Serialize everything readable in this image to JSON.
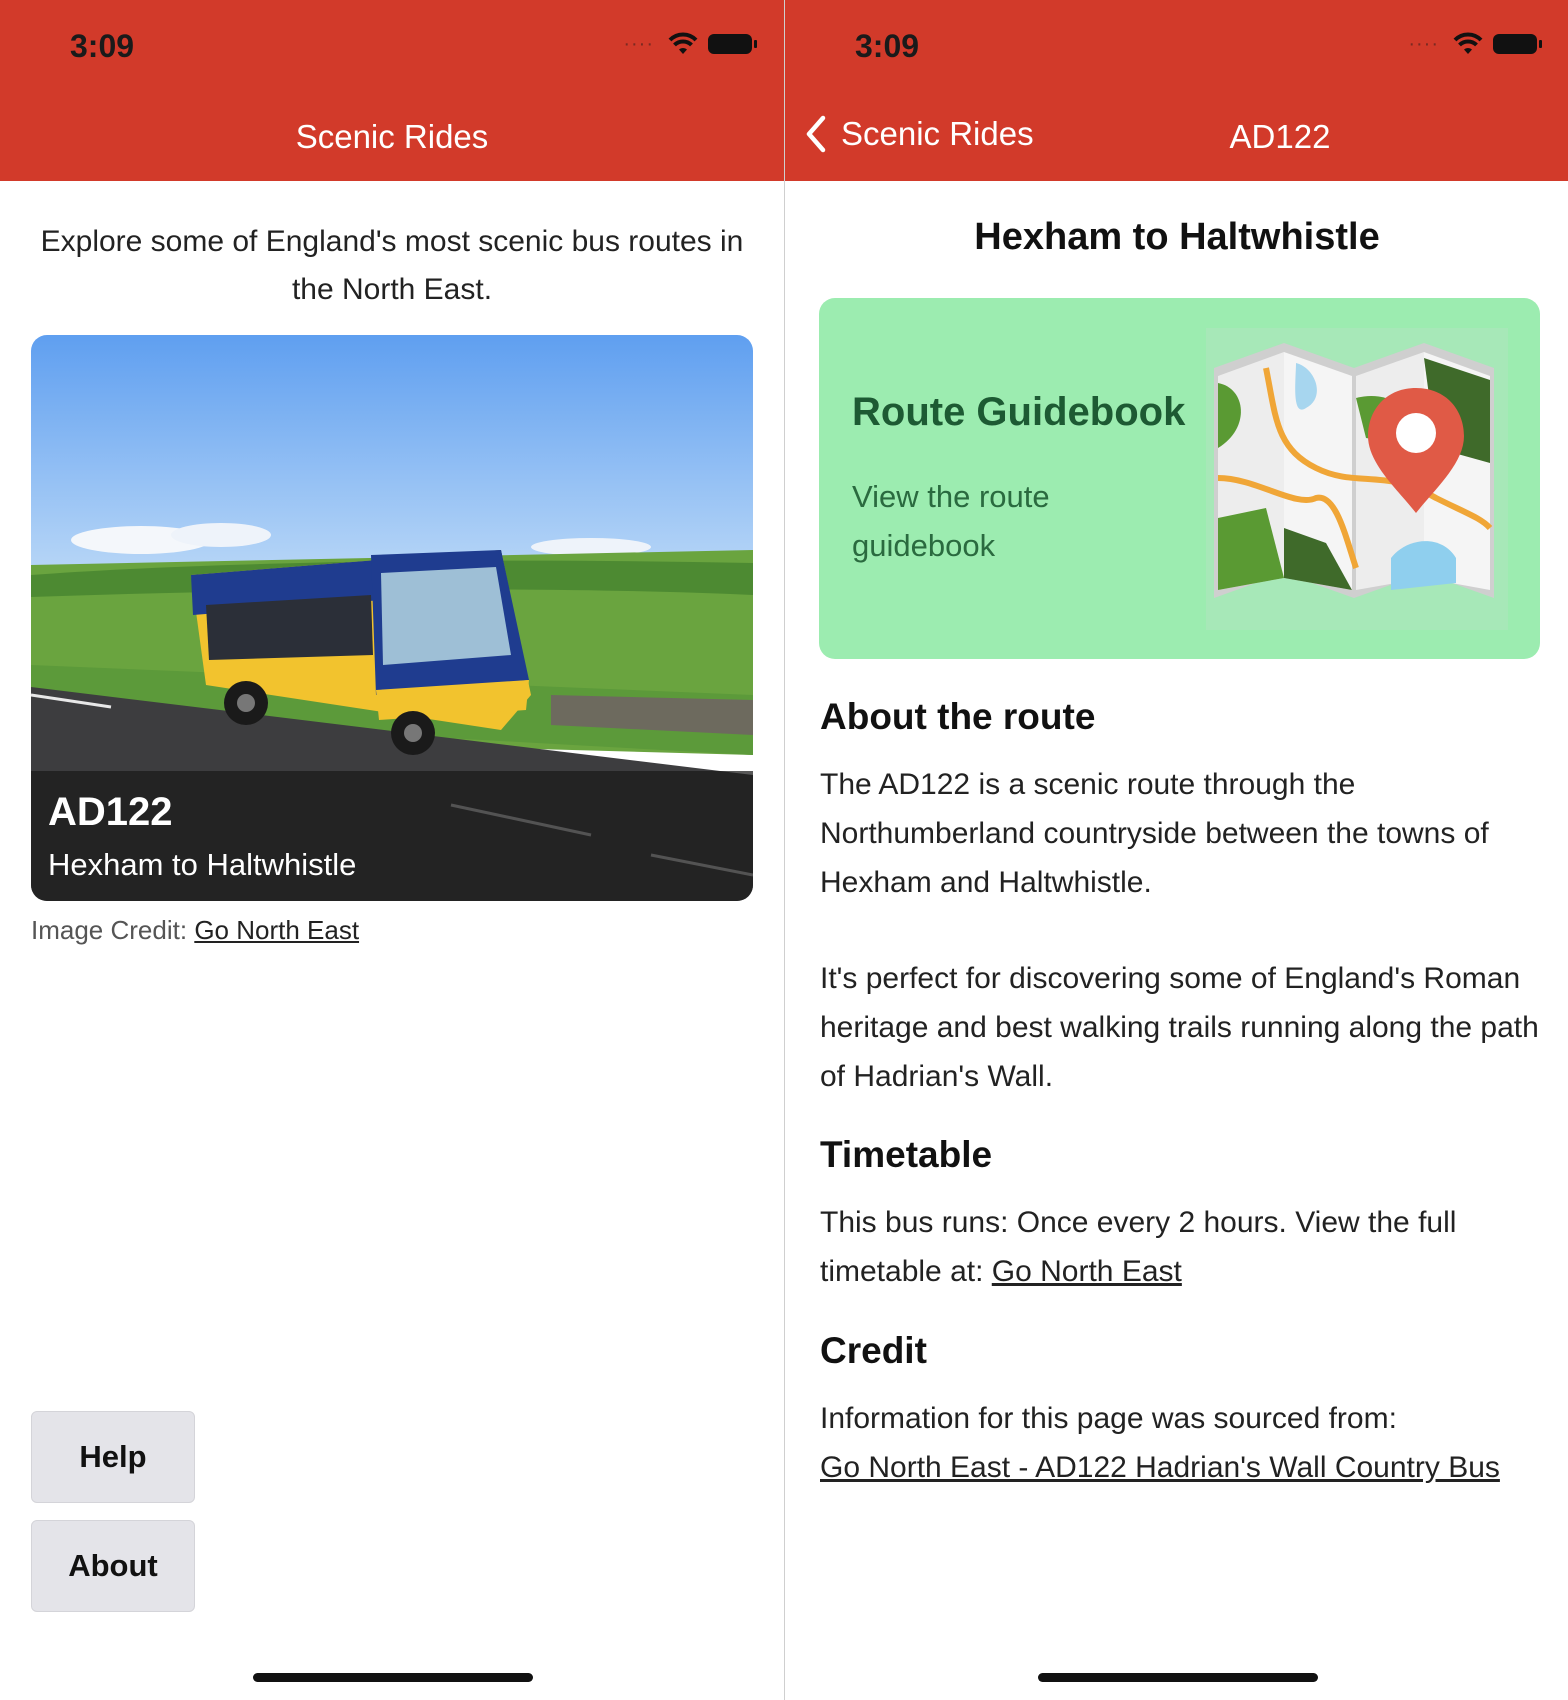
{
  "colors": {
    "nav_bar": "#d23a2a",
    "guidebook_card": "#9cecb0",
    "button_bg": "#e4e4e9"
  },
  "left_screen": {
    "status": {
      "time": "3:09",
      "icons": [
        "cellular-icon",
        "wifi-icon",
        "battery-icon"
      ]
    },
    "nav": {
      "title": "Scenic Rides"
    },
    "intro": "Explore some of England's most scenic bus routes in the North East.",
    "route_card": {
      "code": "AD122",
      "name": "Hexham to Haltwhistle"
    },
    "image_credit": {
      "label": "Image Credit:",
      "link": "Go North East"
    },
    "buttons": {
      "help": "Help",
      "about": "About"
    }
  },
  "right_screen": {
    "status": {
      "time": "3:09"
    },
    "nav": {
      "back_label": "Scenic Rides",
      "title": "AD122"
    },
    "route_title": "Hexham to Haltwhistle",
    "guidebook": {
      "title": "Route Guidebook",
      "subtitle": "View the route guidebook"
    },
    "about": {
      "heading": "About the route",
      "paragraph1": "The AD122 is a scenic route through the Northumberland countryside between the towns of Hexham and Haltwhistle.",
      "paragraph2": "It's perfect for discovering some of England's Roman heritage and best walking trails running along the path of Hadrian's Wall."
    },
    "timetable": {
      "heading": "Timetable",
      "text": "This bus runs: Once every 2 hours. View the full timetable at:",
      "link": "Go North East"
    },
    "credit": {
      "heading": "Credit",
      "text": "Information for this page was sourced from:",
      "link": "Go North East - AD122 Hadrian's Wall Country Bus"
    }
  }
}
